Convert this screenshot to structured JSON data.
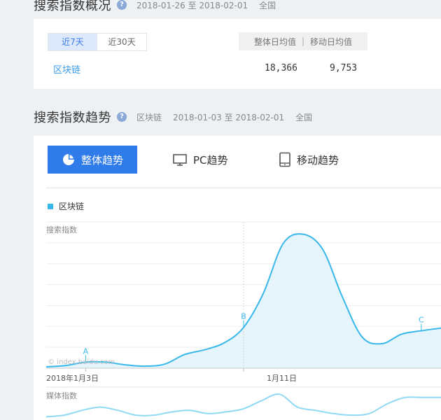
{
  "overview": {
    "title": "搜索指数概况",
    "date_range": "2018-01-26 至 2018-02-01",
    "region": "全国",
    "tabs": [
      "近7天",
      "近30天"
    ],
    "active_tab": "近7天",
    "col_total": "整体日均值",
    "col_mobile": "移动日均值",
    "keyword": "区块链",
    "total_avg": "18,366",
    "mobile_avg": "9,753"
  },
  "trend": {
    "title": "搜索指数趋势",
    "keyword": "区块链",
    "date_range": "2018-01-03 至 2018-02-01",
    "region": "全国",
    "tabs": [
      {
        "label": "整体趋势",
        "icon": "pie-chart-icon",
        "active": true
      },
      {
        "label": "PC趋势",
        "icon": "monitor-icon",
        "active": false
      },
      {
        "label": "移动趋势",
        "icon": "phone-icon",
        "active": false
      }
    ],
    "watermark": "© index.baidu.com"
  },
  "colors": {
    "accent": "#2f7bea",
    "series": "#38b8ea",
    "area": "#e6f5fc",
    "media": "#8fd9f4"
  },
  "chart_data": [
    {
      "type": "area",
      "ylabel": "搜索指数",
      "legend": [
        "区块链"
      ],
      "x_tick_labels": [
        "2018年1月3日",
        "1月11日"
      ],
      "x": [
        "1/1",
        "1/2",
        "1/3",
        "1/4",
        "1/5",
        "1/6",
        "1/7",
        "1/8",
        "1/9",
        "1/10",
        "1/11",
        "1/12",
        "1/13",
        "1/14",
        "1/15",
        "1/16",
        "1/17",
        "1/18",
        "1/19",
        "1/20",
        "1/21"
      ],
      "series": [
        {
          "name": "区块链",
          "values": [
            2,
            4,
            9,
            9,
            5,
            3,
            6,
            20,
            27,
            37,
            60,
            110,
            183,
            197,
            175,
            105,
            46,
            36,
            50,
            55,
            59
          ]
        }
      ],
      "annotations": [
        {
          "label": "A",
          "x": "1/3"
        },
        {
          "label": "B",
          "x": "1/11"
        },
        {
          "label": "C",
          "x": "1/20"
        }
      ],
      "ylim": [
        0,
        215
      ],
      "grid": true
    },
    {
      "type": "line",
      "ylabel": "媒体指数",
      "x": [
        "1/1",
        "1/2",
        "1/3",
        "1/4",
        "1/5",
        "1/6",
        "1/7",
        "1/8",
        "1/9",
        "1/10",
        "1/11",
        "1/12",
        "1/13",
        "1/14",
        "1/15",
        "1/16",
        "1/17",
        "1/18",
        "1/19",
        "1/20",
        "1/21",
        "1/22",
        "1/23"
      ],
      "series": [
        {
          "name": "区块链",
          "values": [
            2,
            3,
            6,
            8,
            6,
            3,
            3,
            5,
            6,
            4,
            5,
            7,
            12,
            16,
            8,
            6,
            4,
            3,
            4,
            10,
            14,
            14,
            14
          ]
        }
      ],
      "ylim": [
        0,
        20
      ],
      "grid": false
    }
  ]
}
